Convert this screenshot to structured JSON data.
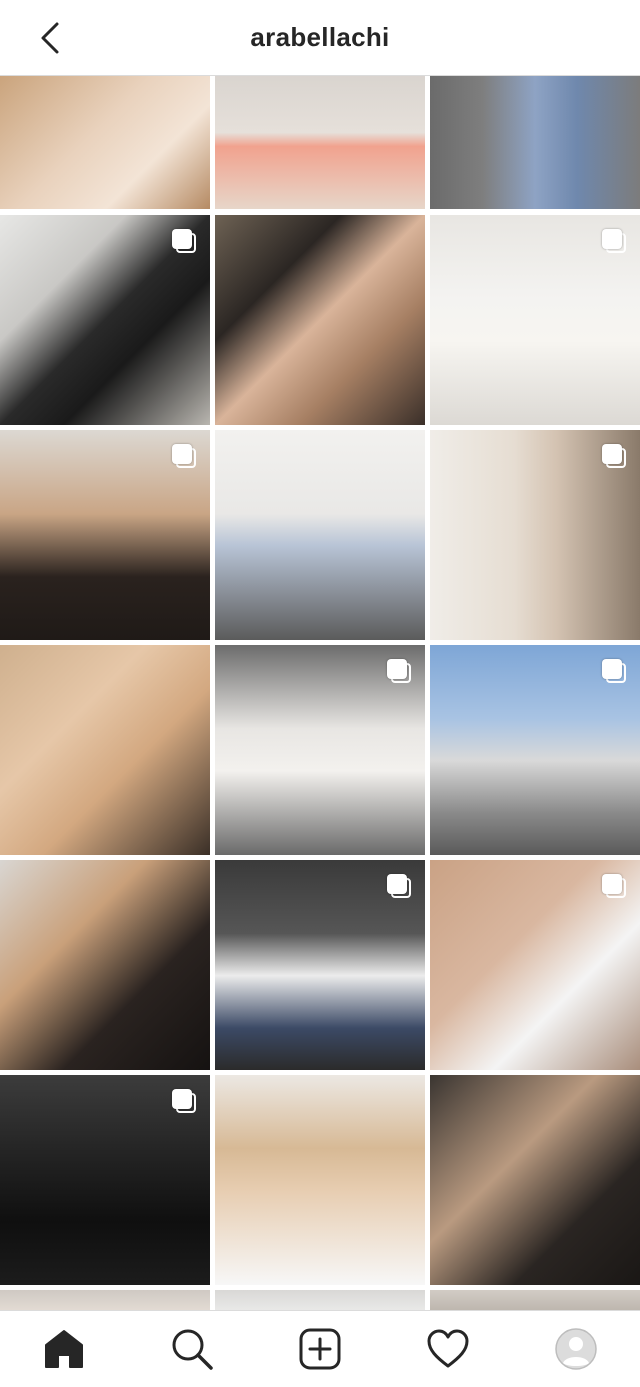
{
  "header": {
    "title": "arabellachi"
  },
  "grid": {
    "tiles": [
      {
        "row": 0,
        "col": 0,
        "multi": false,
        "bg": "linear-gradient(135deg,#c9a27a 0%,#e9d2bd 45%,#f3e4d6 70%,#b58a63 100%)"
      },
      {
        "row": 0,
        "col": 1,
        "multi": false,
        "bg": "linear-gradient(180deg,#d8d3ce 0%,#e6e0da 45%,#f1a28e 55%,#e7d6c9 100%)"
      },
      {
        "row": 0,
        "col": 2,
        "multi": false,
        "bg": "linear-gradient(90deg,#6b6b6b 0%,#7e7e7e 25%,#8ea3c4 50%,#6f88ad 70%,#7c7c7c 100%)"
      },
      {
        "row": 1,
        "col": 0,
        "multi": true,
        "bg": "linear-gradient(135deg,#e7e7e5 0%,#c9c8c5 30%,#2a2a2a 50%,#1a1a1a 65%,#b9b6b0 100%)"
      },
      {
        "row": 1,
        "col": 1,
        "multi": false,
        "bg": "linear-gradient(135deg,#6e6254 0%,#2b2623 30%,#d9b49a 50%,#a67f63 70%,#3a2f29 100%)"
      },
      {
        "row": 1,
        "col": 2,
        "multi": true,
        "bg": "linear-gradient(180deg,#e8e6e2 0%,#f4f3f1 40%,#f7f5f1 60%,#dcd9d4 100%)"
      },
      {
        "row": 2,
        "col": 0,
        "multi": true,
        "bg": "linear-gradient(180deg,#dcd8d2 0%,#c9a585 40%,#2a221e 70%,#1f1a17 100%)"
      },
      {
        "row": 2,
        "col": 1,
        "multi": false,
        "bg": "linear-gradient(180deg,#f2f1ef 0%,#e9e8e6 40%,#b8c4d6 55%,#5b5b5b 100%)"
      },
      {
        "row": 2,
        "col": 2,
        "multi": true,
        "bg": "linear-gradient(90deg,#f0ede8 0%,#e6ddd2 40%,#d4c3b2 60%,#8a7a6a 100%)"
      },
      {
        "row": 3,
        "col": 0,
        "multi": false,
        "bg": "linear-gradient(135deg,#cfb08e 0%,#e6c7a8 35%,#d3a880 60%,#3a2f27 100%)"
      },
      {
        "row": 3,
        "col": 1,
        "multi": true,
        "bg": "linear-gradient(180deg,#6c6c6c 0%,#e8e6e3 40%,#f3f1ee 60%,#6a6a6a 100%)"
      },
      {
        "row": 3,
        "col": 2,
        "multi": true,
        "bg": "linear-gradient(180deg,#7ea6d6 0%,#a8c3e3 35%,#d9d9d9 55%,#8a8a8a 80%,#5a5a5a 100%)"
      },
      {
        "row": 4,
        "col": 0,
        "multi": false,
        "bg": "linear-gradient(135deg,#d9d6d2 0%,#c9a07a 35%,#2a2320 65%,#151211 100%)"
      },
      {
        "row": 4,
        "col": 1,
        "multi": true,
        "bg": "linear-gradient(180deg,#3a3a3a 0%,#565656 35%,#ececec 55%,#3c4a66 80%,#2b2b2b 100%)"
      },
      {
        "row": 4,
        "col": 2,
        "multi": true,
        "bg": "linear-gradient(135deg,#caa285 0%,#d9b7a0 40%,#f4f4f4 65%,#a98e7c 100%)"
      },
      {
        "row": 5,
        "col": 0,
        "multi": true,
        "bg": "linear-gradient(180deg,#3c3c3c 0%,#222222 40%,#0f0f0f 70%,#1c1c1c 100%)"
      },
      {
        "row": 5,
        "col": 1,
        "multi": false,
        "bg": "linear-gradient(180deg,#ece8e3 0%,#d7b995 35%,#e7cdb1 55%,#f7f7f7 100%)"
      },
      {
        "row": 5,
        "col": 2,
        "multi": false,
        "bg": "linear-gradient(135deg,#3a3531 0%,#b99a80 40%,#2a2522 70%,#1a1715 100%)"
      },
      {
        "row": 6,
        "col": 0,
        "multi": false,
        "bg": "linear-gradient(180deg,#cfc9c3 0%,#e6ded6 100%)"
      },
      {
        "row": 6,
        "col": 1,
        "multi": true,
        "bg": "linear-gradient(180deg,#d9d8d6 0%,#ececeb 100%)"
      },
      {
        "row": 6,
        "col": 2,
        "multi": false,
        "bg": "linear-gradient(180deg,#d2ccc5 0%,#b9b2aa 100%)"
      }
    ]
  },
  "tabbar": {
    "tabs": [
      {
        "icon": "home-icon",
        "active": true
      },
      {
        "icon": "search-icon",
        "active": false
      },
      {
        "icon": "add-post-icon",
        "active": false
      },
      {
        "icon": "heart-icon",
        "active": false
      },
      {
        "icon": "profile-avatar-icon",
        "active": false
      }
    ]
  }
}
